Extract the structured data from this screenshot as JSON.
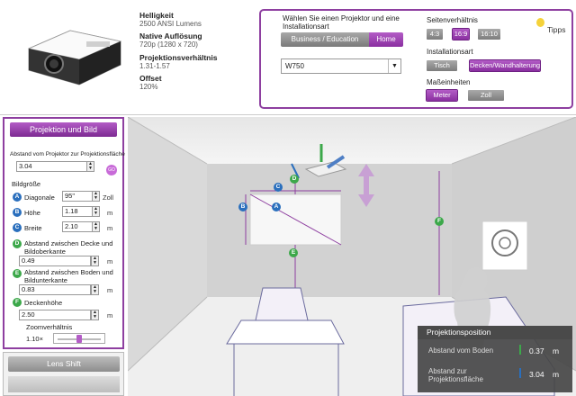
{
  "product": {
    "specs": [
      {
        "label": "Helligkeit",
        "value": "2500 ANSI Lumens"
      },
      {
        "label": "Native Auflösung",
        "value": "720p (1280 x 720)"
      },
      {
        "label": "Projektionsverhältnis",
        "value": "1.31-1.57"
      },
      {
        "label": "Offset",
        "value": "120%"
      }
    ]
  },
  "selector": {
    "title": "Wählen Sie einen Projektor und eine Installationsart",
    "segments": [
      "Business / Education",
      "Home"
    ],
    "active_segment": "Home",
    "model_value": "W750",
    "aspect_label": "Seitenverhältnis",
    "aspect_options": [
      "4:3",
      "16:9",
      "16:10"
    ],
    "aspect_selected": "16:9",
    "install_label": "Installationsart",
    "install_options": [
      "Tisch",
      "Decken/Wandhalterung"
    ],
    "install_selected": "Decken/Wandhalterung",
    "units_label": "Maßeinheiten",
    "unit_options": [
      "Meter",
      "Zoll"
    ],
    "unit_selected": "Meter",
    "tips_label": "Tipps"
  },
  "left_panel": {
    "header": "Projektion und Bild",
    "distance_caption": "Abstand vom Projektor zur Projektionsfläche",
    "distance_value": "3.04",
    "go_label": "GO",
    "image_size_label": "Bildgröße",
    "diagonal": {
      "badge": "A",
      "label": "Diagonale",
      "value": "95\"",
      "unit": "Zoll"
    },
    "height": {
      "badge": "B",
      "label": "Höhe",
      "value": "1.18",
      "unit": "m"
    },
    "width": {
      "badge": "C",
      "label": "Breite",
      "value": "2.10",
      "unit": "m"
    },
    "ceiling_gap": {
      "badge": "D",
      "label": "Abstand zwischen Decke und Bildoberkante",
      "value": "0.49",
      "unit": "m"
    },
    "floor_gap": {
      "badge": "E",
      "label": "Abstand zwischen Boden und Bildunterkante",
      "value": "0.83",
      "unit": "m"
    },
    "ceiling_height": {
      "badge": "F",
      "label": "Deckenhöhe",
      "value": "2.50",
      "unit": "m"
    },
    "zoom_label": "Zoomverhältnis",
    "zoom_value": "1.10×",
    "zoom_level": 0.5,
    "lens_shift_label": "Lens Shift"
  },
  "room_labels": {
    "a": "A",
    "b": "B",
    "c": "C",
    "d": "D",
    "e": "E",
    "f": "F"
  },
  "position_panel": {
    "title": "Projektionsposition",
    "floor_label": "Abstand vom Boden",
    "floor_value": "0.37",
    "floor_unit": "m",
    "screen_label": "Abstand zur Projektionsfläche",
    "screen_value": "3.04",
    "screen_unit": "m"
  },
  "colors": {
    "accent": "#8e3fa0",
    "badge_blue": "#2a6fbd",
    "badge_green": "#3ca84a"
  }
}
